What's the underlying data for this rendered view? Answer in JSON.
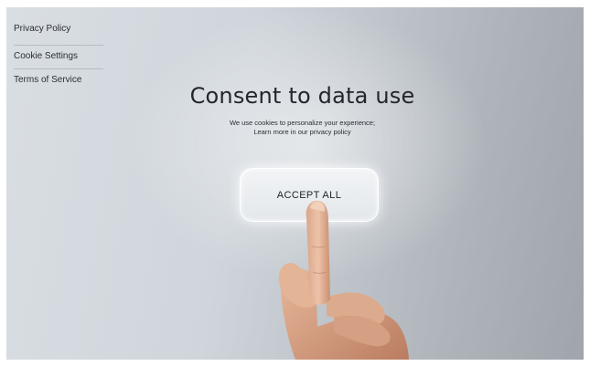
{
  "sidebar": {
    "items": [
      {
        "label": "Privacy Policy"
      },
      {
        "label": "Cookie Settings"
      },
      {
        "label": "Terms of Service"
      }
    ]
  },
  "dialog": {
    "title": "Consent to data use",
    "subtitle_line1": "We use cookies to personalize your experience;",
    "subtitle_line2": "Learn more in our privacy policy",
    "accept_label": "ACCEPT ALL"
  },
  "colors": {
    "background_light": "#d9dee3",
    "background_dark": "#9fa5ab",
    "text": "#23272c",
    "button_fill": "#eceff2"
  }
}
